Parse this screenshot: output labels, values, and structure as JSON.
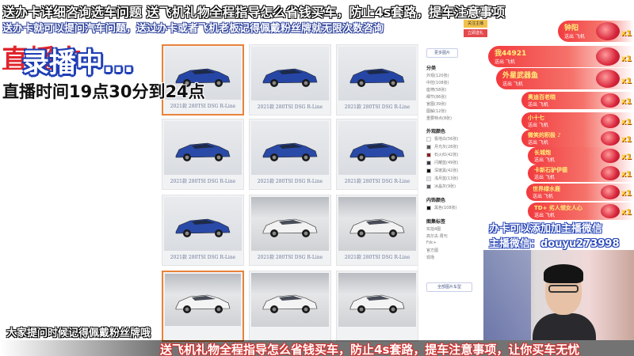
{
  "overlay": {
    "top_banner": "送办卡详细咨询选车问题  送飞机礼物全程指导怎么省钱买车，防止4s套路，提车注意事项",
    "second_banner": "送办卡就可以提问汽车问题，送过办卡或者飞机老板记得佩戴粉丝牌就无限次数咨询",
    "background_red_word": "直播中",
    "recording_status": "录播中...",
    "schedule": "直播时间19点30分到24点",
    "fan_reminder": "大家提问时候记得佩戴粉丝牌哦",
    "bottom_banner": "送飞机礼物全程指导怎么省钱买车，防止4s套路，提车注意事项，让你买车无忧"
  },
  "gallery": {
    "caption": "2021款 280TSI DSG R-Line",
    "selected_index": 9,
    "thumbs": [
      {
        "scene": "studio",
        "color": "#2646a6"
      },
      {
        "scene": "studio",
        "color": "#2646a6"
      },
      {
        "scene": "studio",
        "color": "#2646a6"
      },
      {
        "scene": "studio",
        "color": "#2a4aa8"
      },
      {
        "scene": "studio",
        "color": "#2a4aa8"
      },
      {
        "scene": "studio",
        "color": "#2a4aa8"
      },
      {
        "scene": "studio",
        "color": "#2a4aa8"
      },
      {
        "scene": "showroom",
        "color": "#f2f2f2"
      },
      {
        "scene": "showroom",
        "color": "#f2f2f2"
      },
      {
        "scene": "showroom",
        "color": "#f4f4f4"
      },
      {
        "scene": "showroom",
        "color": "#f4f4f4"
      },
      {
        "scene": "showroom",
        "color": "#f4f4f4"
      }
    ]
  },
  "filter": {
    "top_button": "更多图片",
    "sections": [
      {
        "title": "分类",
        "options": [
          "外观(120张)",
          "中控(108张)",
          "座椅(58张)",
          "细节(86张)",
          "官图(39张)",
          "图解(12张)",
          "重要特点(8张)"
        ]
      },
      {
        "title": "外观颜色",
        "colors": [
          {
            "label": "极地白(56张)",
            "swatch": "#f5f5f5"
          },
          {
            "label": "月光灰(28张)",
            "swatch": "#555555"
          },
          {
            "label": "石火红(42张)",
            "swatch": "#8b1c1c"
          },
          {
            "label": "闪耀蓝(49张)",
            "swatch": "#333a44"
          },
          {
            "label": "深邃黑(42张)",
            "swatch": "#111111"
          },
          {
            "label": "浅月蓝(13张)",
            "swatch": "#dfe5ee"
          },
          {
            "label": "冰晶灰(9张)",
            "swatch": "#5a5c60"
          }
        ]
      },
      {
        "title": "内饰颜色",
        "colors": [
          {
            "label": "黑色(108张)",
            "swatch": "#111111"
          }
        ]
      },
      {
        "title": "图集标签",
        "options": [
          "实拍4图",
          "高尔夫·周刊",
          "Fdc+",
          "官方图",
          "现场"
        ]
      }
    ],
    "bottom_button": "全部图片车型"
  },
  "topright": {
    "btn1": "关注主播",
    "btn2": "立即送礼"
  },
  "gifts": [
    {
      "name": "钟阳",
      "sub": "送出 飞机",
      "count": "x1"
    },
    {
      "name": "我44921",
      "sub": "送出 飞机",
      "count": "x1"
    },
    {
      "name": "外星武器鱼",
      "sub": "送出 飞机",
      "count": "x1"
    },
    {
      "name": "奥迪百老晓",
      "sub": "送出 飞机",
      "count": "x1"
    },
    {
      "name": "小十七",
      "sub": "送出 飞机",
      "count": "x1"
    },
    {
      "name": "微笑的积极 ♪",
      "sub": "送出 飞机",
      "count": "x1"
    },
    {
      "name": "长城炮",
      "sub": "送出 飞机",
      "count": "x1"
    },
    {
      "name": "卡新石驴伊德",
      "sub": "送出 飞机",
      "count": "x1"
    },
    {
      "name": "世界绿水鹿",
      "sub": "送出 飞机",
      "count": "x1"
    },
    {
      "name": "TD+ 劣人领女人心",
      "sub": "送出 飞机",
      "count": "x1"
    }
  ],
  "contact": {
    "line1": "办卡可以添加加主播微信",
    "line2": "主播微信：douyu273998"
  }
}
